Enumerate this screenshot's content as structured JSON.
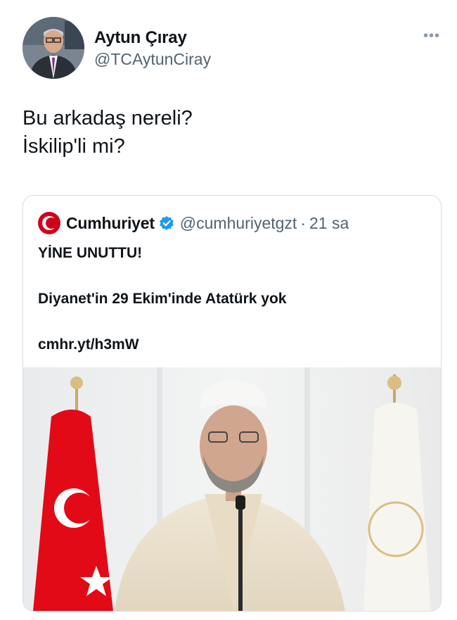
{
  "tweet": {
    "display_name": "Aytun Çıray",
    "handle": "@TCAytunCiray",
    "more_icon": "more-dots-icon",
    "text_lines": [
      "Bu arkadaş nereli?",
      "İskilip'li mi?"
    ]
  },
  "quote": {
    "source_name": "Cumhuriyet",
    "source_handle": "@cumhuriyetgzt",
    "time": "21 sa",
    "separator": "·",
    "headline": "YİNE UNUTTU!",
    "subline": "Diyanet'in 29 Ekim'inde Atatürk yok",
    "link": "cmhr.yt/h3mW",
    "logo_icon": "cumhuriyet-logo-icon",
    "verified_icon": "verified-badge-icon"
  },
  "colors": {
    "text": "#0f1419",
    "secondary": "#536471",
    "verified": "#1d9bf0",
    "logo_red": "#d0021b",
    "flag_red": "#e30a17"
  }
}
